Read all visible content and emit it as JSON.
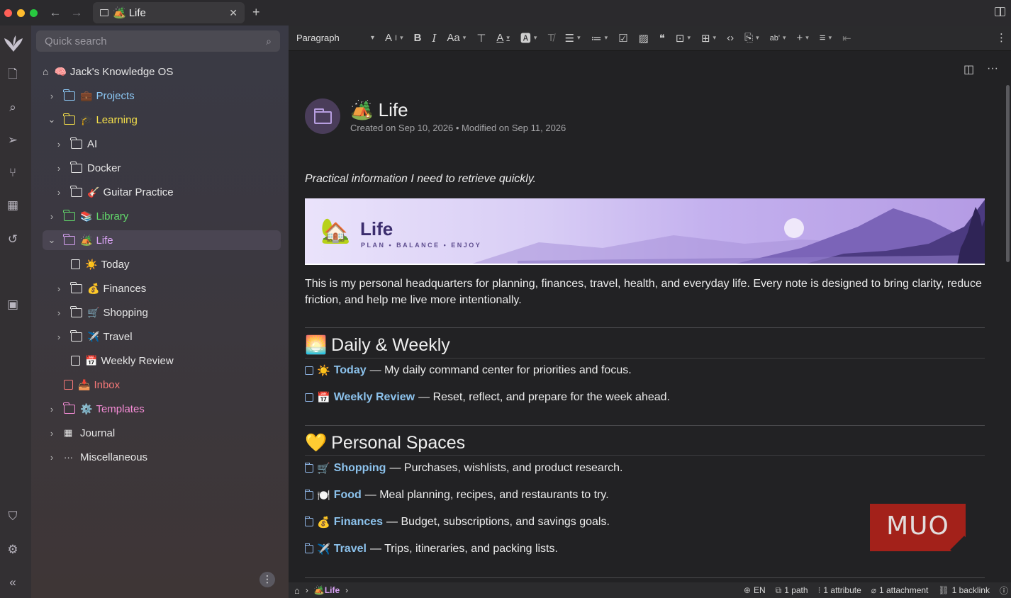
{
  "window": {
    "tab_title": "Life",
    "tab_emoji": "🏕️",
    "traffic_colors": [
      "#ff5f57",
      "#febc2e",
      "#28c840"
    ]
  },
  "sidebar": {
    "search_placeholder": "Quick search",
    "root": {
      "emoji": "🧠",
      "label": "Jack's Knowledge OS"
    },
    "items": [
      {
        "label": "Projects",
        "emoji": "💼",
        "color": "#8cc8f5"
      },
      {
        "label": "Learning",
        "emoji": "🎓",
        "color": "#f5e04a"
      },
      {
        "label": "AI",
        "emoji": "",
        "color": "#e6e6e6"
      },
      {
        "label": "Docker",
        "emoji": "",
        "color": "#e6e6e6"
      },
      {
        "label": "Guitar Practice",
        "emoji": "🎸",
        "color": "#e6e6e6"
      },
      {
        "label": "Library",
        "emoji": "📚",
        "color": "#62d96b"
      },
      {
        "label": "Life",
        "emoji": "🏕️",
        "color": "#d9a3f5"
      },
      {
        "label": "Today",
        "emoji": "☀️",
        "color": "#e6e6e6"
      },
      {
        "label": "Finances",
        "emoji": "💰",
        "color": "#e6e6e6"
      },
      {
        "label": "Shopping",
        "emoji": "🛒",
        "color": "#e6e6e6"
      },
      {
        "label": "Travel",
        "emoji": "✈️",
        "color": "#e6e6e6"
      },
      {
        "label": "Weekly Review",
        "emoji": "📅",
        "color": "#e6e6e6"
      },
      {
        "label": "Inbox",
        "emoji": "📥",
        "color": "#f57878"
      },
      {
        "label": "Templates",
        "emoji": "⚙️",
        "color": "#f58cd6"
      },
      {
        "label": "Journal",
        "emoji": "",
        "color": "#e6e6e6"
      },
      {
        "label": "Miscellaneous",
        "emoji": "",
        "color": "#e6e6e6"
      }
    ]
  },
  "toolbar": {
    "paragraph_label": "Paragraph"
  },
  "document": {
    "title": "Life",
    "title_emoji": "🏕️",
    "meta": "Created on Sep 10, 2026 • Modified on Sep 11, 2026",
    "intro": "Practical information I need to retrieve quickly.",
    "banner": {
      "title": "Life",
      "subtitle": "PLAN  •  BALANCE  •  ENJOY"
    },
    "paragraph": "This is my personal headquarters for planning, finances, travel, health, and everyday life. Every note is designed to bring clarity, reduce friction, and help me live more intentionally.",
    "sections": [
      {
        "emoji": "🌅",
        "heading": "Daily & Weekly",
        "links": [
          {
            "emoji": "☀️",
            "label": "Today",
            "desc": "— My daily command center for priorities and focus.",
            "kind": "note"
          },
          {
            "emoji": "📅",
            "label": "Weekly Review",
            "desc": "— Reset, reflect, and prepare for the week ahead.",
            "kind": "note"
          }
        ]
      },
      {
        "emoji": "💛",
        "heading": "Personal Spaces",
        "links": [
          {
            "emoji": "🛒",
            "label": "Shopping",
            "desc": "— Purchases, wishlists, and product research.",
            "kind": "folder"
          },
          {
            "emoji": "🍽️",
            "label": "Food",
            "desc": "— Meal planning, recipes, and restaurants to try.",
            "kind": "folder"
          },
          {
            "emoji": "💰",
            "label": "Finances",
            "desc": "— Budget, subscriptions, and savings goals.",
            "kind": "folder"
          },
          {
            "emoji": "✈️",
            "label": "Travel",
            "desc": "— Trips, itineraries, and packing lists.",
            "kind": "folder"
          }
        ]
      }
    ]
  },
  "watermark": "MUO",
  "statusbar": {
    "breadcrumb_emoji": "🏕️",
    "breadcrumb": "Life",
    "language": "EN",
    "paths": "1 path",
    "attributes": "1 attribute",
    "attachments": "1 attachment",
    "backlinks": "1 backlink"
  }
}
